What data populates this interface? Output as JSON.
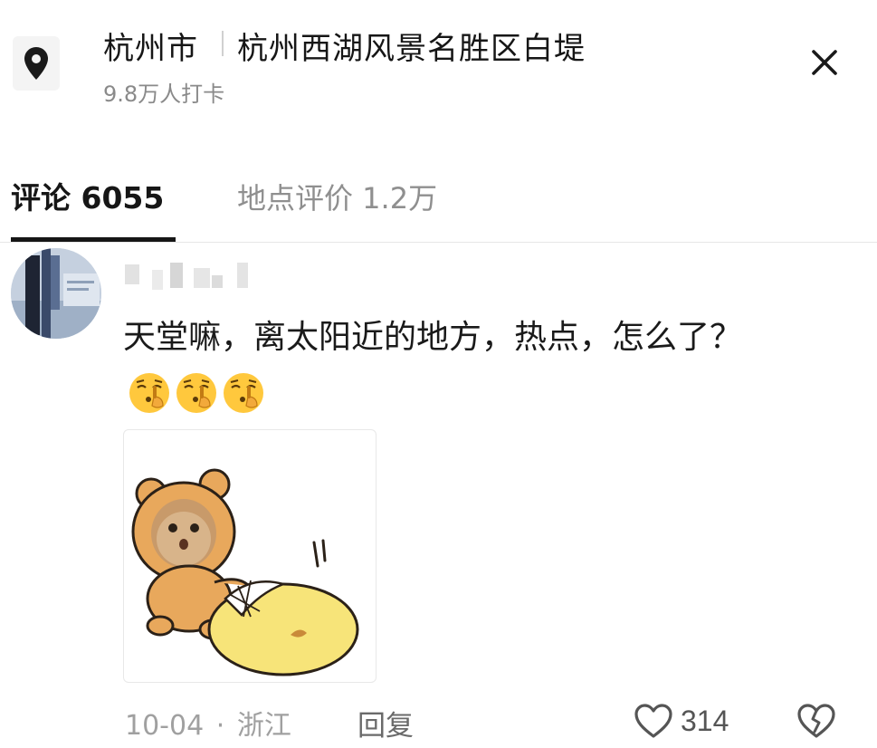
{
  "header": {
    "city": "杭州市",
    "place": "杭州西湖风景名胜区白堤",
    "checkins": "9.8万人打卡",
    "icons": {
      "location": "map-pin-icon",
      "close": "close-icon"
    }
  },
  "tabs": [
    {
      "label": "评论 6055",
      "active": true
    },
    {
      "label": "地点评价 1.2万",
      "active": false
    }
  ],
  "comment": {
    "text": "天堂嘛，离太阳近的地方，热点，怎么了？",
    "emoji_count": 3,
    "date": "10-04",
    "separator": "·",
    "region": "浙江",
    "reply_label": "回复",
    "likes": "314",
    "icons": {
      "like": "heart-icon",
      "dislike": "broken-heart-icon",
      "emoji": "shush-face-emoji"
    }
  },
  "colors": {
    "text": "#161616",
    "muted": "#8a8a8a",
    "accent": "#161616",
    "emoji": "#FFC83D"
  }
}
